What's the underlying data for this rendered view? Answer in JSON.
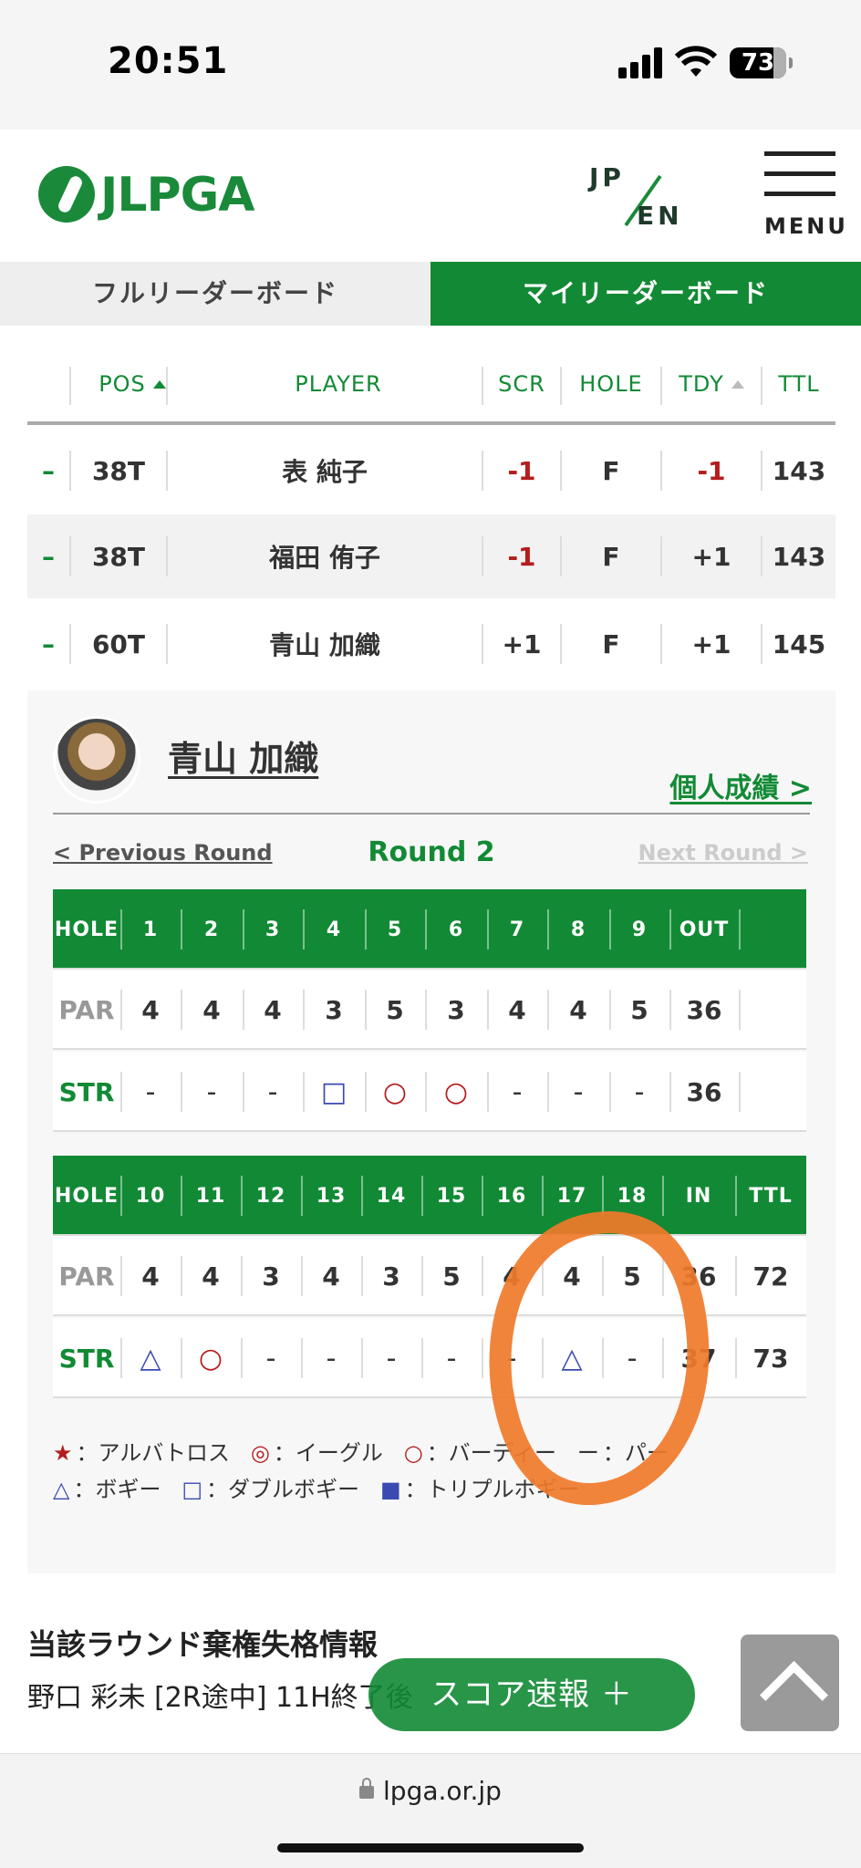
{
  "status_bar": {
    "time": "20:51",
    "battery": "73"
  },
  "header": {
    "logo_text": "JLPGA",
    "lang_jp": "JP",
    "lang_en": "EN",
    "menu_label": "MENU"
  },
  "tabs": {
    "full": "フルリーダーボード",
    "my": "マイリーダーボード"
  },
  "leaderboard": {
    "headers": {
      "pos": "POS",
      "player": "PLAYER",
      "scr": "SCR",
      "hole": "HOLE",
      "tdy": "TDY",
      "ttl": "TTL"
    },
    "rows": [
      {
        "move": "–",
        "pos": "38T",
        "player": "表 純子",
        "scr": "-1",
        "hole": "F",
        "tdy": "-1",
        "ttl": "143"
      },
      {
        "move": "–",
        "pos": "38T",
        "player": "福田 侑子",
        "scr": "-1",
        "hole": "F",
        "tdy": "+1",
        "ttl": "143"
      },
      {
        "move": "–",
        "pos": "60T",
        "player": "青山 加織",
        "scr": "+1",
        "hole": "F",
        "tdy": "+1",
        "ttl": "145"
      }
    ]
  },
  "player_card": {
    "name": "青山 加織",
    "stats_link": "個人成績 >",
    "prev_round": "< Previous Round",
    "round": "Round 2",
    "next_round": "Next Round >",
    "front": {
      "hole_label": "HOLE",
      "holes": [
        "1",
        "2",
        "3",
        "4",
        "5",
        "6",
        "7",
        "8",
        "9"
      ],
      "total_label": "OUT",
      "par_label": "PAR",
      "par": [
        "4",
        "4",
        "4",
        "3",
        "5",
        "3",
        "4",
        "4",
        "5"
      ],
      "par_total": "36",
      "str_label": "STR",
      "str": [
        "-",
        "-",
        "-",
        "□",
        "○",
        "○",
        "-",
        "-",
        "-"
      ],
      "str_total": "36"
    },
    "back": {
      "hole_label": "HOLE",
      "holes": [
        "10",
        "11",
        "12",
        "13",
        "14",
        "15",
        "16",
        "17",
        "18"
      ],
      "total_label": "IN",
      "ttl_label": "TTL",
      "par_label": "PAR",
      "par": [
        "4",
        "4",
        "3",
        "4",
        "3",
        "5",
        "4",
        "4",
        "5"
      ],
      "par_total": "36",
      "par_ttl": "72",
      "str_label": "STR",
      "str": [
        "△",
        "○",
        "-",
        "-",
        "-",
        "-",
        "-",
        "△",
        "-"
      ],
      "str_total": "37",
      "str_ttl": "73"
    },
    "legend": [
      {
        "sym": "★",
        "label": "：アルバトロス"
      },
      {
        "sym": "◎",
        "label": "：イーグル"
      },
      {
        "sym": "○",
        "label": "：バーディー"
      },
      {
        "sym": "ー",
        "label": "：パー"
      },
      {
        "sym": "△",
        "label": "：ボギー"
      },
      {
        "sym": "□",
        "label": "：ダブルボギー"
      },
      {
        "sym": "■",
        "label": "：トリプルボギー"
      }
    ]
  },
  "info": {
    "title": "当該ラウンド棄権失格情報",
    "text": "野口 彩未 [2R途中] 11H終了後"
  },
  "score_button": "スコア速報 ＋",
  "browser": {
    "url": "lpga.or.jp"
  }
}
